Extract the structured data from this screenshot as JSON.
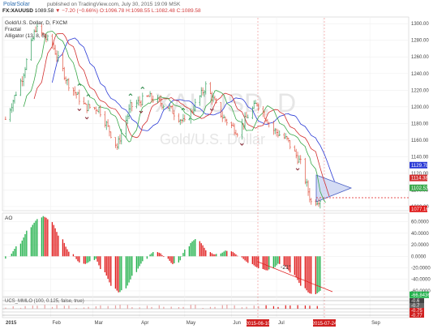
{
  "header": {
    "brand": "PolarSolar",
    "meta": "published on TradingView.com, July 30, 2015 19:09 MSK",
    "symbol": "FX:XAUUSD",
    "last": "1089.58",
    "change": "▼ −7.20 (−0.66%)",
    "ohlc": "O:1096.78 H:1098.55 L:1082.48 C:1089.58"
  },
  "legend": {
    "line1": "Gold/U.S. Dollar, D, FXCM",
    "line2": "Fractal",
    "line3": "Alligator (13, 8, 5)"
  },
  "watermark": {
    "main": "XAUUSD, D",
    "sub": "Gold/U.S. Dollar"
  },
  "ao_label": "AO",
  "mmlo_label": "UCS_MMLO (100, 0.125, false, true)",
  "annotation": "-21°",
  "colors": {
    "up": "#2e9d5b",
    "down": "#e0523f",
    "ao_up": "#22b14c",
    "ao_down": "#e01b1b",
    "jaw": "#2b3bd6",
    "teeth": "#d22f2f",
    "lips": "#3aa84a",
    "triangle": "#b9c6ef"
  },
  "chart_data": [
    {
      "type": "candlestick",
      "title": "Gold/U.S. Dollar, D, FXCM",
      "y_axis_ticks": [
        1300,
        1280,
        1260,
        1240,
        1220,
        1200,
        1180,
        1160,
        1140,
        1120,
        1100,
        1080
      ],
      "ylim": [
        1075,
        1308
      ],
      "x_axis_ticks": [
        "2015",
        "Feb",
        "Mar",
        "Apr",
        "May",
        "Jun",
        "Jul",
        "Aug",
        "Sep"
      ],
      "price_tags": [
        {
          "label": "1129.78",
          "value": 1129.78,
          "color": "#2b3bd6"
        },
        {
          "label": "1114.38",
          "value": 1114.38,
          "color": "#d22f2f"
        },
        {
          "label": "1102.53",
          "value": 1102.53,
          "color": "#3aa84a"
        },
        {
          "label": "1077.16",
          "value": 1077.16,
          "color": "#e01b1b"
        }
      ],
      "approx_close_path": [
        [
          "2015-01-02",
          1185
        ],
        [
          "2015-01-13",
          1235
        ],
        [
          "2015-01-22",
          1295
        ],
        [
          "2015-02-02",
          1275
        ],
        [
          "2015-02-12",
          1230
        ],
        [
          "2015-02-24",
          1200
        ],
        [
          "2015-03-05",
          1198
        ],
        [
          "2015-03-17",
          1152
        ],
        [
          "2015-03-26",
          1200
        ],
        [
          "2015-04-07",
          1212
        ],
        [
          "2015-04-20",
          1200
        ],
        [
          "2015-05-01",
          1180
        ],
        [
          "2015-05-15",
          1225
        ],
        [
          "2015-05-26",
          1188
        ],
        [
          "2015-06-05",
          1170
        ],
        [
          "2015-06-18",
          1205
        ],
        [
          "2015-06-29",
          1172
        ],
        [
          "2015-07-08",
          1160
        ],
        [
          "2015-07-17",
          1132
        ],
        [
          "2015-07-24",
          1085
        ],
        [
          "2015-07-30",
          1089
        ]
      ]
    },
    {
      "type": "bar",
      "title": "AO",
      "y_axis_ticks": [
        "60.0000",
        "40.0000",
        "20.0000",
        "0.0000",
        "-20.0000",
        "-40.0000",
        "-60.0000"
      ],
      "ylim": [
        -70,
        75
      ],
      "last_value_label": "-66.8436",
      "approx_values": [
        -4,
        8,
        20,
        35,
        52,
        62,
        70,
        66,
        52,
        34,
        16,
        4,
        -8,
        -14,
        -10,
        -4,
        -22,
        -38,
        -55,
        -64,
        -55,
        -40,
        -22,
        -10,
        2,
        8,
        5,
        -4,
        -14,
        -10,
        8,
        24,
        30,
        20,
        8,
        3,
        5,
        10,
        8,
        2,
        -6,
        -12,
        -18,
        -22,
        -25,
        -20,
        -12,
        -18,
        -28,
        -40,
        -54,
        -64,
        -66,
        -60
      ]
    },
    {
      "type": "table",
      "title": "UCS_MMLO (100, 0.125, false, true)",
      "y_axis_ticks": [
        "-0.6",
        "-0.7",
        "-0.75",
        "-0.77"
      ]
    }
  ],
  "date_tags": [
    "2015-06-10",
    "2015-07-24"
  ]
}
